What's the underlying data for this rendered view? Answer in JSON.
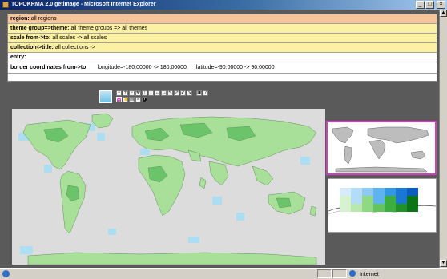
{
  "window": {
    "title": "TOPOKRMA 2.0 getimage - Microsoft Internet Explorer",
    "minimize": "_",
    "maximize": "□",
    "close": "×"
  },
  "filters": {
    "region": {
      "label": "region:",
      "value": "all regions"
    },
    "theme": {
      "label": "theme group=>theme:",
      "value": "all theme groups => all themes"
    },
    "scale": {
      "label": "scale from->to:",
      "value": "all scales -> all scales"
    },
    "collection": {
      "label": "collection->title:",
      "value": "all collections ->"
    },
    "entry": {
      "label": "entry:",
      "value": ""
    },
    "border": {
      "label": "border coordinates from->to:",
      "longitude": "longitude=-180.00000 -> 180.00000",
      "latitude": "latitude=-90.00000 -> 90.00000"
    }
  },
  "toolbar": {
    "tools": [
      "lock",
      "zoom-in",
      "zoom-out",
      "pan",
      "arrow-up",
      "arrow-down",
      "arrow-left",
      "arrow-right",
      "arrow-upleft",
      "arrow-upright",
      "arrow-downleft",
      "arrow-downright",
      "select",
      "help"
    ],
    "tools_row2": [
      "query",
      "hand",
      "print",
      "list",
      "info"
    ],
    "help_label": "?",
    "active_tool": "query"
  },
  "legend": {
    "colors": [
      [
        "#d6ecfb",
        "#b3dcf7",
        "#8ccaf3",
        "#5fb3ee",
        "#3398e4",
        "#1a78d4",
        "#0c5cc2"
      ],
      [
        "#d8f2d0",
        "#b9e8ae",
        "#8fd983",
        "#63c65d",
        "#3cae3f",
        "#1f9228",
        "#0b7416"
      ]
    ]
  },
  "map_colors": {
    "ocean": "#dcdcdc",
    "land": "#a8e09a",
    "land_dark": "#6cc46a",
    "sea_cell": "#a9def4",
    "highlight": "#d23cbe"
  },
  "status": {
    "zone": "Internet"
  }
}
